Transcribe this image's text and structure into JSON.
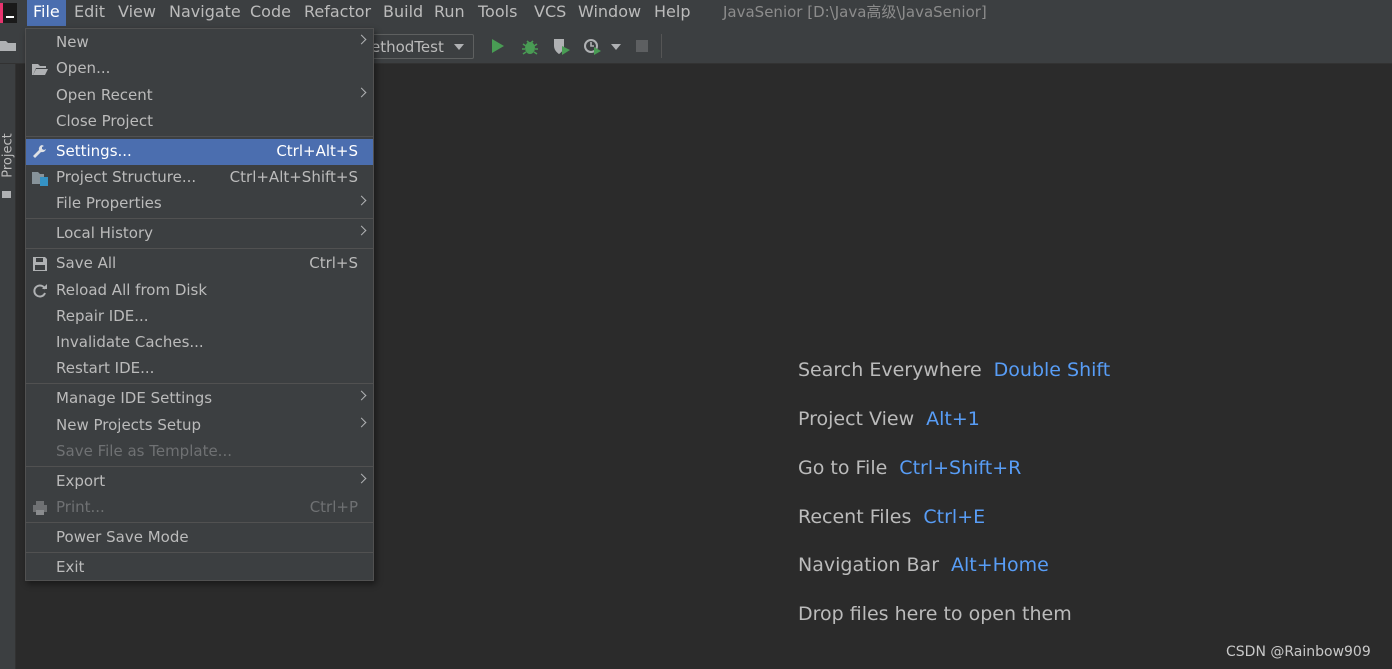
{
  "menubar": {
    "items": [
      "File",
      "Edit",
      "View",
      "Navigate",
      "Code",
      "Refactor",
      "Build",
      "Run",
      "Tools",
      "VCS",
      "Window",
      "Help"
    ],
    "title": "JavaSenior [D:\\Java高级\\JavaSenior]"
  },
  "toolbar": {
    "run_config": "ethodTest"
  },
  "side_panel": {
    "project_tab": "Project"
  },
  "file_menu": {
    "items": [
      {
        "label": "New"
      },
      {
        "label": "Open..."
      },
      {
        "label": "Open Recent"
      },
      {
        "label": "Close Project"
      },
      {
        "label": "Settings...",
        "shortcut": "Ctrl+Alt+S"
      },
      {
        "label": "Project Structure...",
        "shortcut": "Ctrl+Alt+Shift+S"
      },
      {
        "label": "File Properties"
      },
      {
        "label": "Local History"
      },
      {
        "label": "Save All",
        "shortcut": "Ctrl+S"
      },
      {
        "label": "Reload All from Disk"
      },
      {
        "label": "Repair IDE..."
      },
      {
        "label": "Invalidate Caches..."
      },
      {
        "label": "Restart IDE..."
      },
      {
        "label": "Manage IDE Settings"
      },
      {
        "label": "New Projects Setup"
      },
      {
        "label": "Save File as Template..."
      },
      {
        "label": "Export"
      },
      {
        "label": "Print...",
        "shortcut": "Ctrl+P"
      },
      {
        "label": "Power Save Mode"
      },
      {
        "label": "Exit"
      }
    ]
  },
  "welcome": {
    "hints": [
      {
        "label": "Search Everywhere",
        "key": "Double Shift"
      },
      {
        "label": "Project View",
        "key": "Alt+1"
      },
      {
        "label": "Go to File",
        "key": "Ctrl+Shift+R"
      },
      {
        "label": "Recent Files",
        "key": "Ctrl+E"
      },
      {
        "label": "Navigation Bar",
        "key": "Alt+Home"
      },
      {
        "label": "Drop files here to open them",
        "key": ""
      }
    ]
  },
  "watermark": "CSDN @Rainbow909",
  "colors": {
    "accent": "#4b6eaf",
    "shortcut_blue": "#589df6",
    "run_green": "#499c54"
  }
}
